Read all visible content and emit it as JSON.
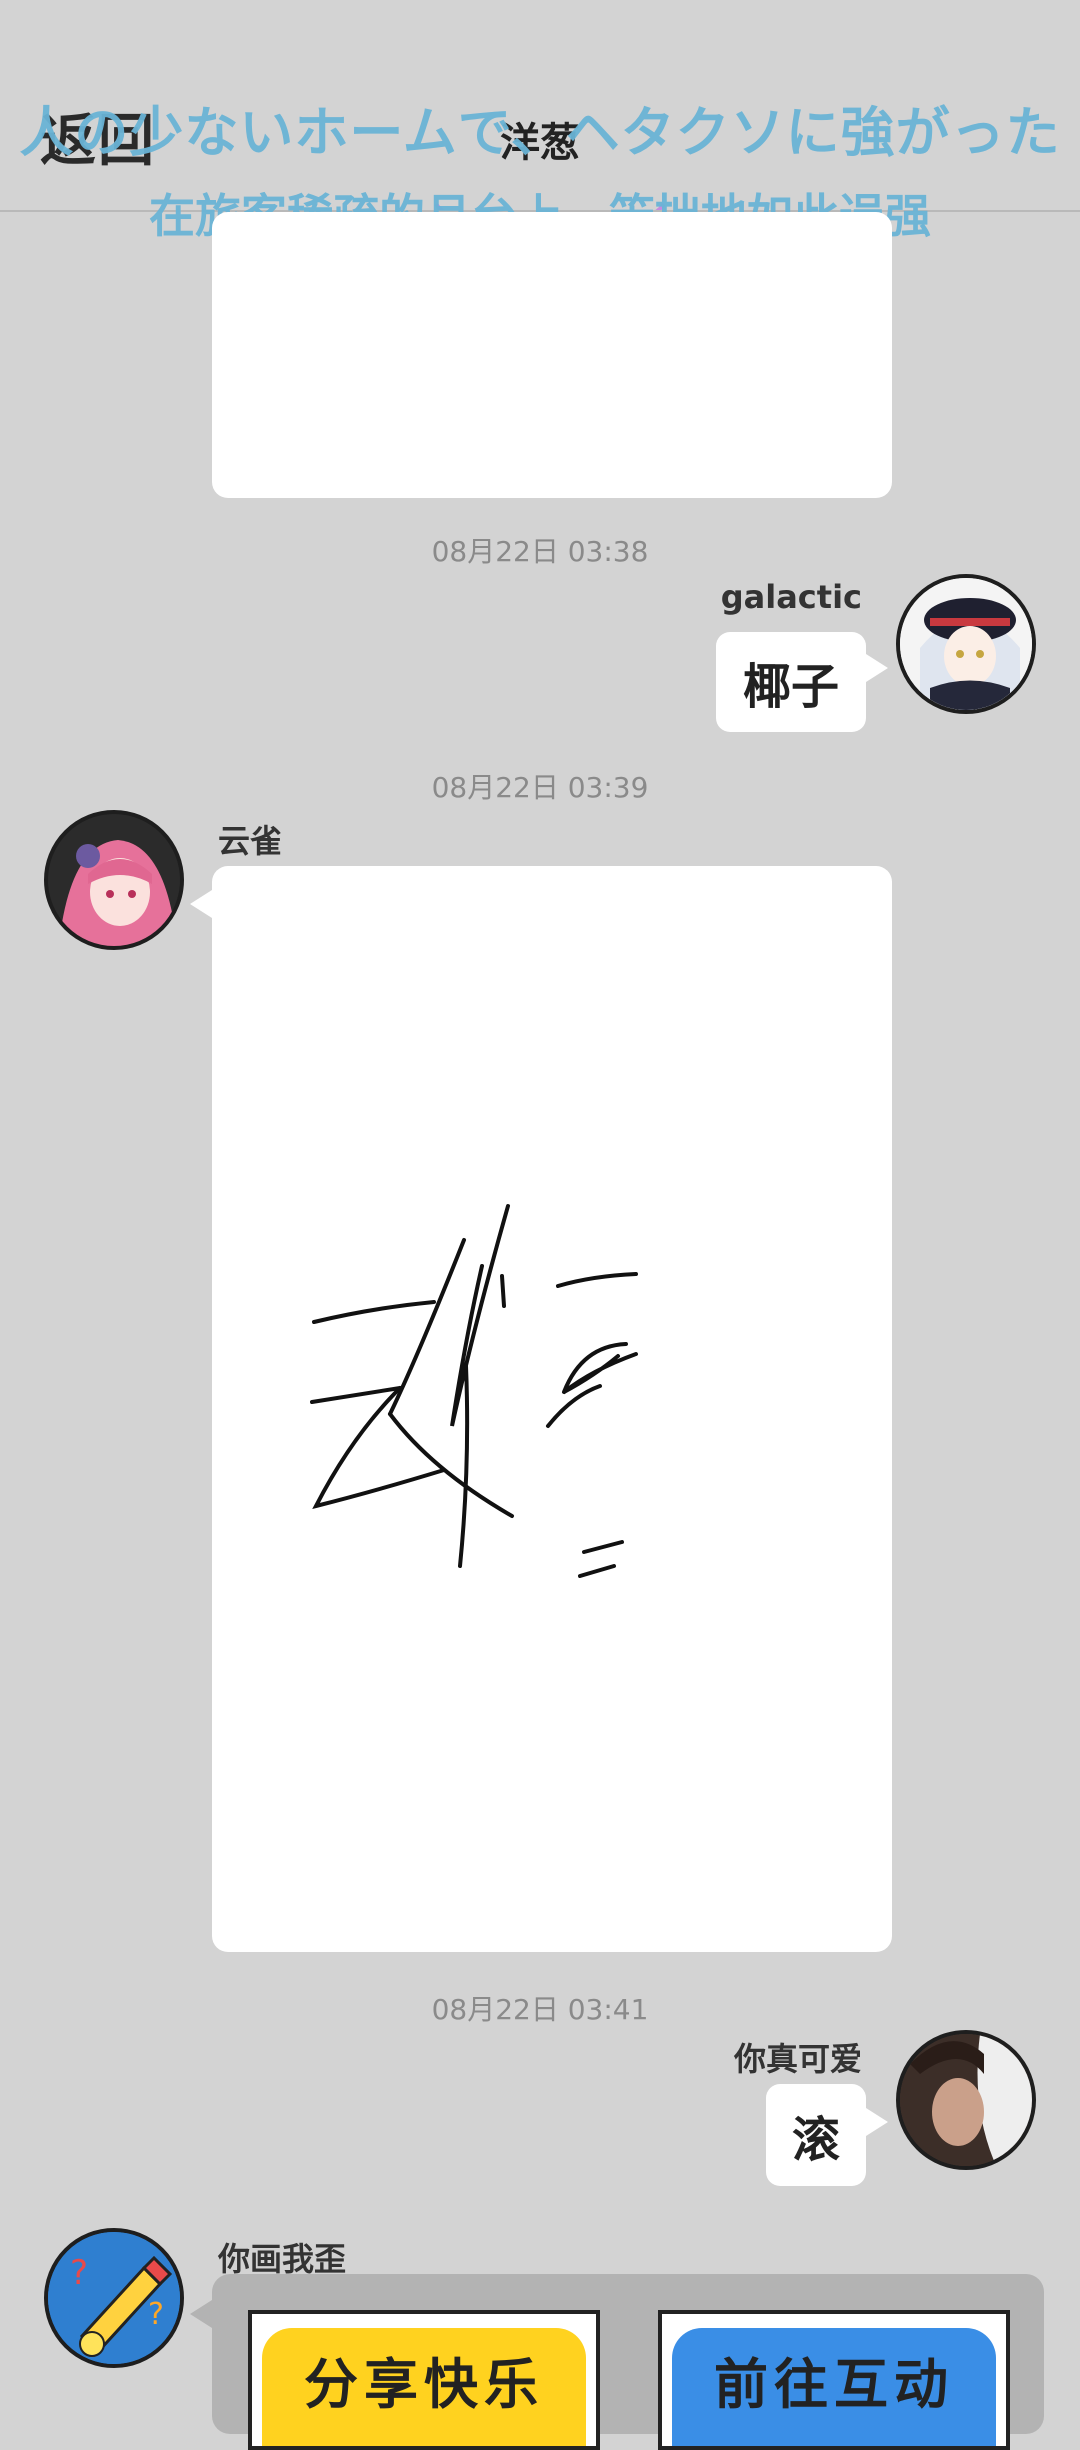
{
  "header": {
    "back_label": "返回",
    "title": "洋葱",
    "lyric_jp": "人の少ないホームで、ヘタクソに強がった",
    "lyric_cn": "在旅客稀疏的月台上，笨拙地如此逞强"
  },
  "messages": [
    {
      "type": "drawing_partial"
    },
    {
      "timestamp": "08月22日  03:38",
      "user": "galactic",
      "text": "椰子",
      "side": "right"
    },
    {
      "timestamp": "08月22日  03:39",
      "user": "云雀",
      "type": "drawing",
      "side": "left"
    },
    {
      "timestamp": "08月22日  03:41",
      "user": "你真可爱",
      "text": "滚",
      "side": "right"
    },
    {
      "user": "你画我歪",
      "side": "left",
      "type": "card",
      "buttons": [
        {
          "label": "分享快乐",
          "color": "#ffd21f"
        },
        {
          "label": "前往互动",
          "color": "#3a8ee6"
        }
      ]
    }
  ],
  "colors": {
    "background": "#d3d3d3",
    "bubble": "#ffffff",
    "overlay_text": "#6ab4d6",
    "card_grey": "#b3b3b3"
  }
}
